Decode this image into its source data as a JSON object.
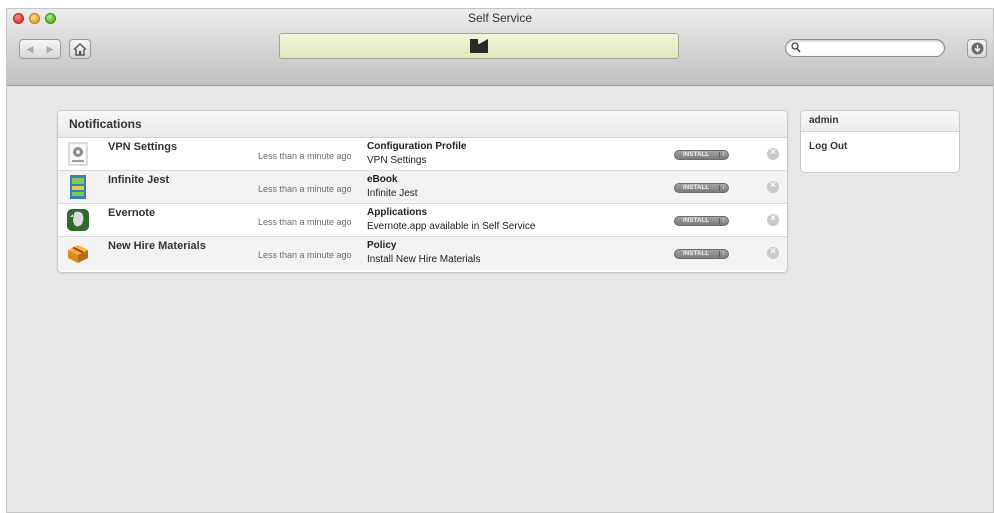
{
  "window": {
    "title": "Self Service"
  },
  "toolbar": {
    "back_icon": "back-arrow-icon",
    "forward_icon": "forward-arrow-icon",
    "home_icon": "home-icon",
    "search_placeholder": "",
    "download_icon": "download-icon"
  },
  "notifications": {
    "title": "Notifications",
    "rows": [
      {
        "name": "VPN Settings",
        "time": "Less than a minute ago",
        "category": "Configuration Profile",
        "detail": "VPN Settings",
        "install_label": "INSTALL",
        "info": "i",
        "dismiss": "×",
        "icon": "config-profile-icon"
      },
      {
        "name": "Infinite Jest",
        "time": "Less than a minute ago",
        "category": "eBook",
        "detail": "Infinite Jest",
        "install_label": "INSTALL",
        "info": "i",
        "dismiss": "×",
        "icon": "book-cover-icon"
      },
      {
        "name": "Evernote",
        "time": "Less than a minute ago",
        "category": "Applications",
        "detail": "Evernote.app available in Self Service",
        "install_label": "INSTALL",
        "info": "i",
        "dismiss": "×",
        "icon": "evernote-icon"
      },
      {
        "name": "New Hire Materials",
        "time": "Less than a minute ago",
        "category": "Policy",
        "detail": "Install New Hire Materials",
        "install_label": "INSTALL",
        "info": "i",
        "dismiss": "×",
        "icon": "package-icon"
      }
    ]
  },
  "user": {
    "name": "admin",
    "logout_label": "Log Out"
  },
  "colors": {
    "lcd_background": "#e6ecc8",
    "install_button": "#8a8a8a"
  }
}
